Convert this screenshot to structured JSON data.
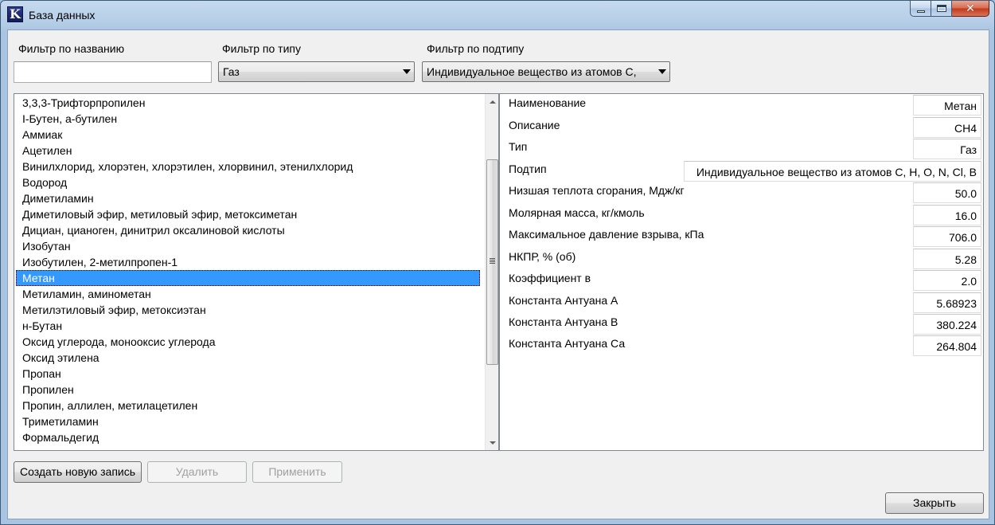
{
  "window": {
    "title": "База данных",
    "icon_letter": "K",
    "minimize_glyph": "",
    "maximize_glyph": "",
    "close_glyph": "✕"
  },
  "filters": {
    "name_label": "Фильтр по названию",
    "name_value": "",
    "type_label": "Фильтр по типу",
    "type_value": "Газ",
    "subtype_label": "Фильтр по подтипу",
    "subtype_value": "Индивидуальное вещество из атомов C,"
  },
  "list": {
    "items": [
      "3,3,3-Трифторпропилен",
      "I-Бутен, a-бутилен",
      "Аммиак",
      "Ацетилен",
      "Винилхлорид, хлорэтен, хлорэтилен, хлорвинил, этенилхлорид",
      "Водород",
      "Диметиламин",
      "Диметиловый эфир, метиловый эфир, метоксиметан",
      "Дициан, цианоген, динитрил оксалиновой кислоты",
      "Изобутан",
      "Изобутилен, 2-метилпропен-1",
      "Метан",
      "Метиламин, аминометан",
      "Метилэтиловый эфир, метоксиэтан",
      "н-Бутан",
      "Оксид углерода, монооксис углерода",
      "Оксид этилена",
      "Пропан",
      "Пропилен",
      "Пропин, аллилен, метилацетилен",
      "Триметиламин",
      "Формальдегид"
    ],
    "selected_index": 11
  },
  "properties": [
    {
      "label": "Наименование",
      "value": "Метан"
    },
    {
      "label": "Описание",
      "value": "CH4"
    },
    {
      "label": "Тип",
      "value": "Газ"
    },
    {
      "label": "Подтип",
      "value": "Индивидуальное вещество из атомов C, H, O, N, Cl, B"
    },
    {
      "label": "Низшая теплота сгорания, Мдж/кг",
      "value": "50.0"
    },
    {
      "label": "Молярная масса, кг/кмоль",
      "value": "16.0"
    },
    {
      "label": "Максимальное давление взрыва, кПа",
      "value": "706.0"
    },
    {
      "label": "НКПР, % (об)",
      "value": "5.28"
    },
    {
      "label": "Коэффициент в",
      "value": "2.0"
    },
    {
      "label": "Константа Антуана А",
      "value": "5.68923"
    },
    {
      "label": "Константа Антуана В",
      "value": "380.224"
    },
    {
      "label": "Константа Антуана Са",
      "value": "264.804"
    }
  ],
  "buttons": {
    "create": "Создать новую запись",
    "delete": "Удалить",
    "apply": "Применить",
    "close": "Закрыть"
  }
}
